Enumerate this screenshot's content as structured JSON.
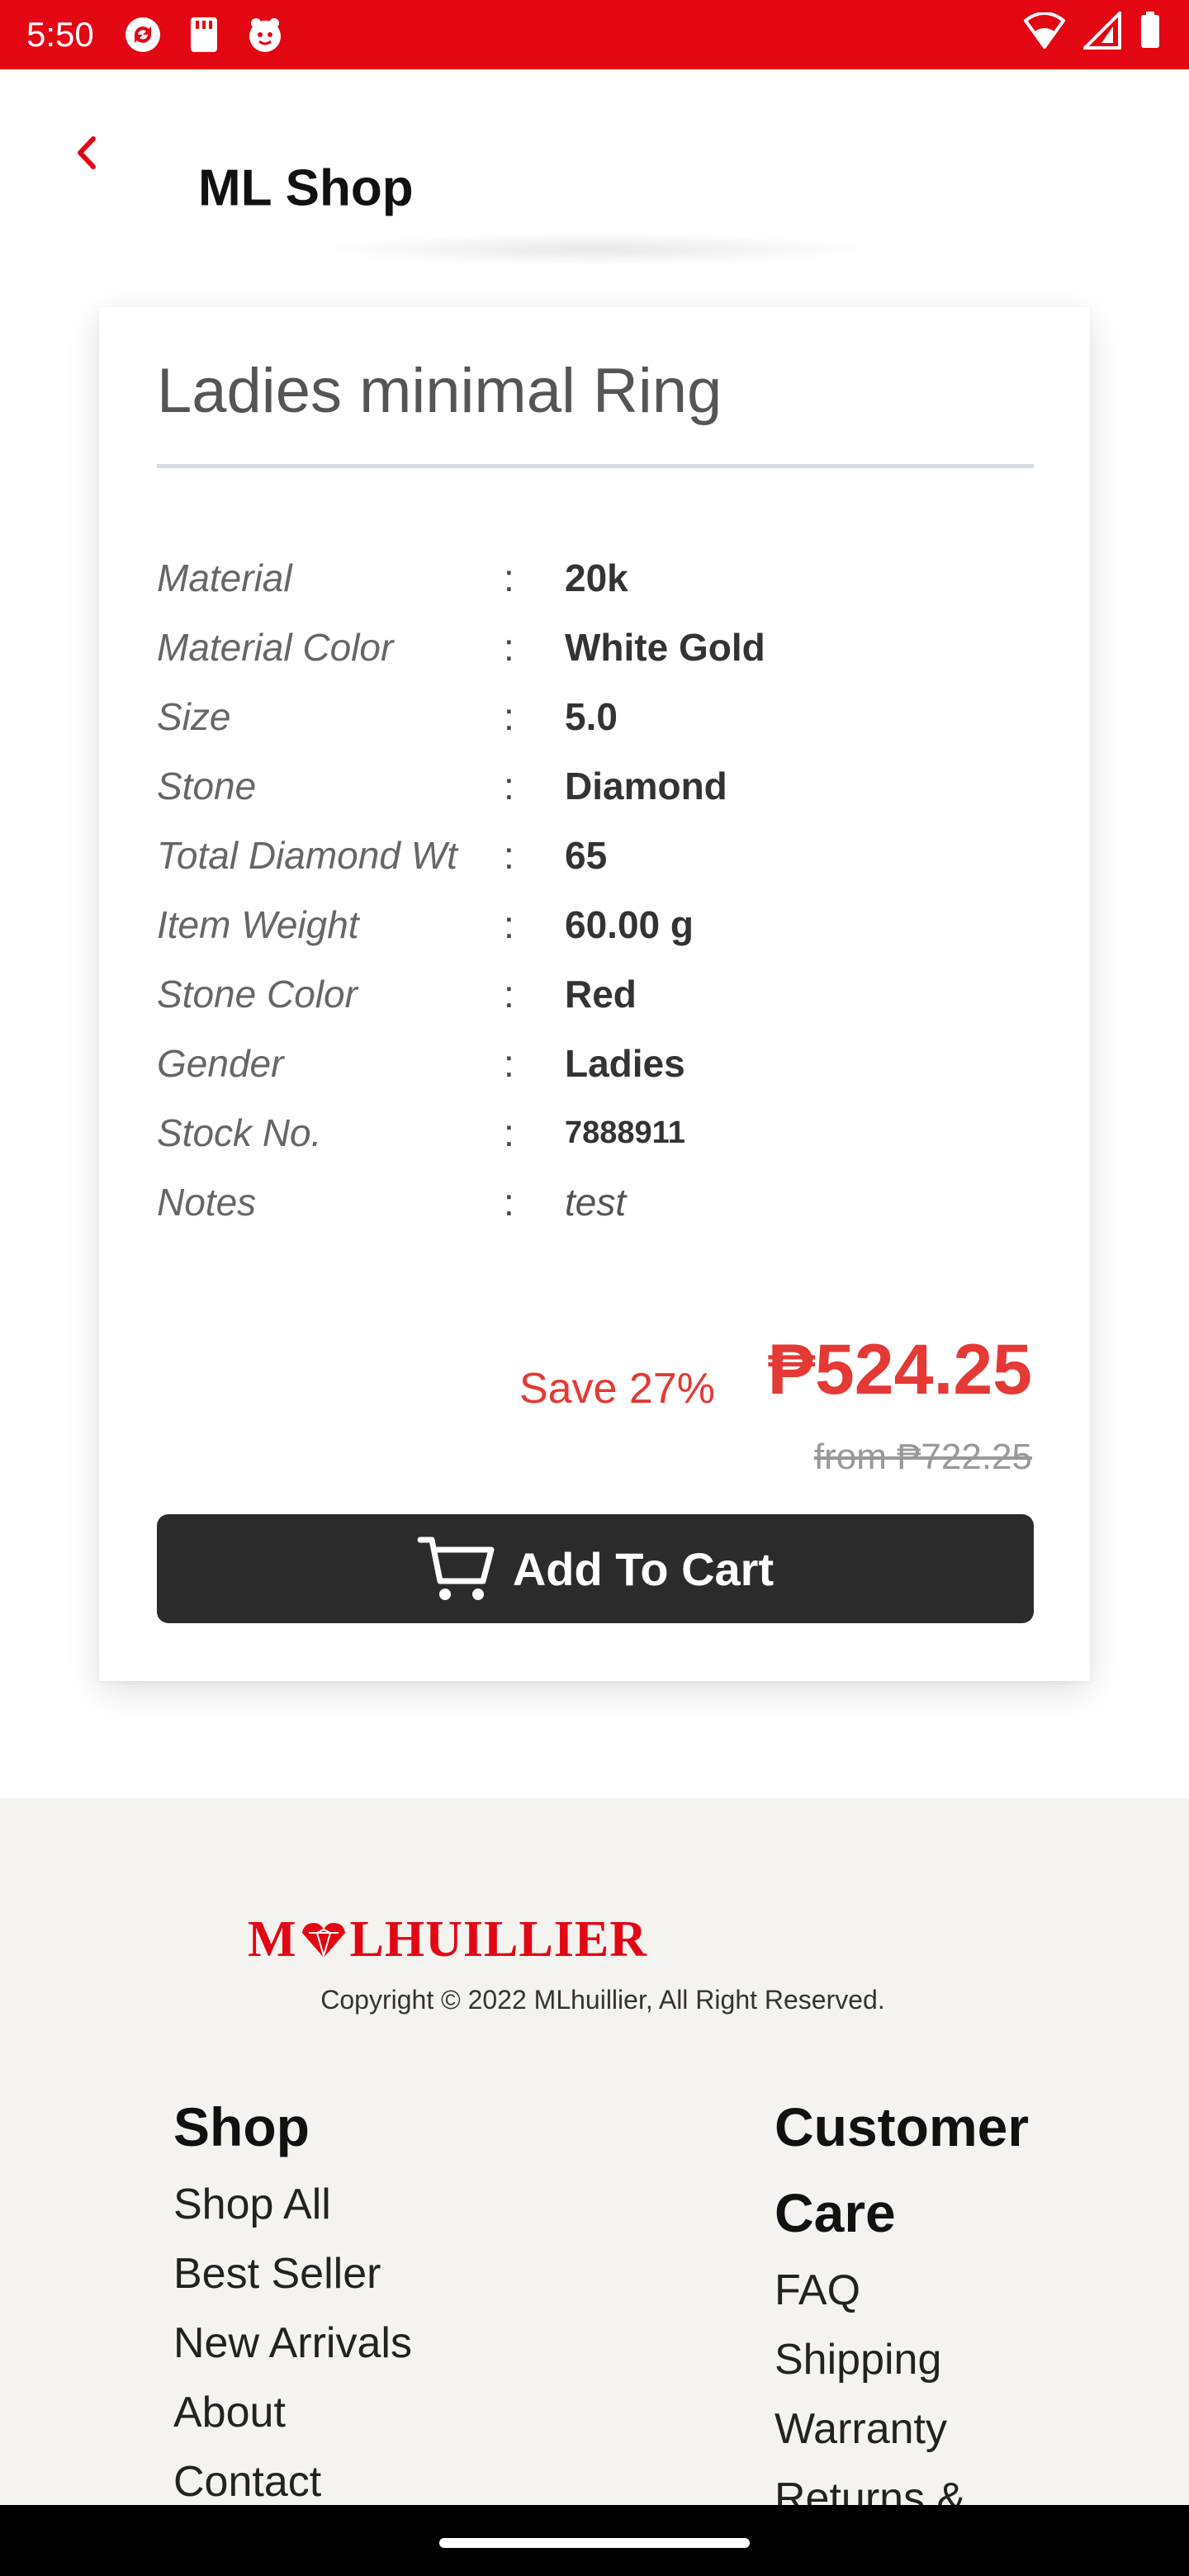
{
  "status_bar": {
    "time": "5:50",
    "icons_left": [
      "app-sync-icon",
      "app-card-icon",
      "app-mascot-icon"
    ],
    "icons_right": [
      "wifi-icon",
      "cellular-signal-icon",
      "battery-icon"
    ],
    "color": "#e30613"
  },
  "app_bar": {
    "title": "ML Shop",
    "back_icon": "back-chevron-icon",
    "accent": "#e30613"
  },
  "product": {
    "title": "Ladies minimal Ring",
    "specs": [
      {
        "label": "Material",
        "value": "20k"
      },
      {
        "label": "Material Color",
        "value": "White Gold"
      },
      {
        "label": "Size",
        "value": "5.0"
      },
      {
        "label": "Stone",
        "value": "Diamond"
      },
      {
        "label": "Total Diamond Wt",
        "value": "65"
      },
      {
        "label": "Item Weight",
        "value": "60.00 g"
      },
      {
        "label": "Stone Color",
        "value": "Red"
      },
      {
        "label": "Gender",
        "value": "Ladies"
      },
      {
        "label": "Stock No.",
        "value": "7888911"
      },
      {
        "label": "Notes",
        "value": "test"
      }
    ],
    "colon": ":",
    "save_text": "Save 27%",
    "price": "₱524.25",
    "original_price": "from ₱722.25",
    "price_color": "#e53935"
  },
  "cart_button": {
    "label": "Add To Cart",
    "icon": "shopping-cart-icon"
  },
  "footer": {
    "logo_text": "MLHUILLIER",
    "logo_prefix": "M",
    "logo_suffix": "LHUILLIER",
    "copyright": "Copyright © 2022 MLhuillier, All Right Reserved.",
    "shop_heading": "Shop",
    "shop_links": [
      "Shop All",
      "Best Seller",
      "New Arrivals",
      "About",
      "Contact"
    ],
    "care_heading_line1": "Customer",
    "care_heading_line2": "Care",
    "care_links": [
      "FAQ",
      "Shipping",
      "Warranty",
      "Returns &"
    ]
  }
}
